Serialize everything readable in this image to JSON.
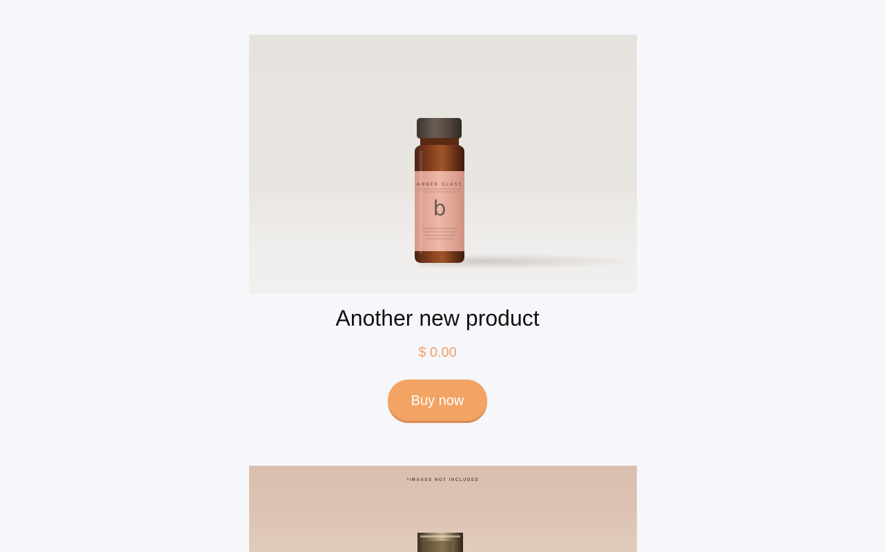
{
  "products": [
    {
      "title": "Another new product",
      "price": "$ 0.00",
      "buy_label": "Buy now",
      "image": {
        "label_brand": "AMBER GLASS",
        "label_letter": "b"
      }
    },
    {
      "image": {
        "notice": "*IMAGES NOT INCLUDED"
      }
    }
  ],
  "colors": {
    "background": "#f5f7fb",
    "accent": "#f3a464",
    "price": "#f0a163",
    "title": "#111111"
  }
}
